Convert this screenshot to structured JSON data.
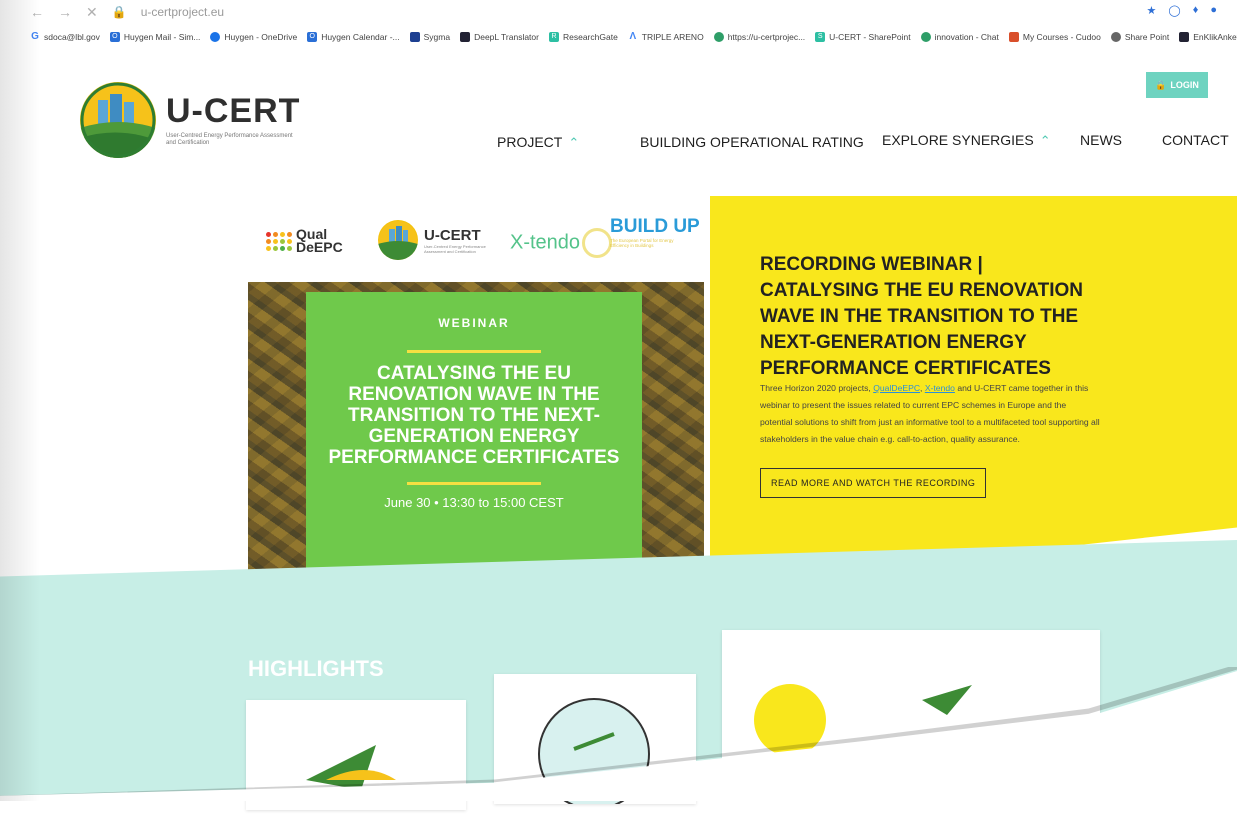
{
  "browser": {
    "url": "u-certproject.eu",
    "bookmarks": [
      {
        "label": "sdoca@lbl.gov",
        "icon": "google-icon"
      },
      {
        "label": "Huygen Mail - Sim...",
        "icon": "outlook-icon"
      },
      {
        "label": "Huygen - OneDrive",
        "icon": "onedrive-icon"
      },
      {
        "label": "Huygen Calendar -...",
        "icon": "outlook-icon"
      },
      {
        "label": "Sygma",
        "icon": "eu-flag-icon"
      },
      {
        "label": "DeepL Translator",
        "icon": "deepl-icon"
      },
      {
        "label": "ResearchGate",
        "icon": "researchgate-icon"
      },
      {
        "label": "TRIPLE ARENO",
        "icon": "triple-icon"
      },
      {
        "label": "https://u-certprojec...",
        "icon": "site-icon"
      },
      {
        "label": "U-CERT - SharePoint",
        "icon": "sharepoint-icon"
      },
      {
        "label": "innovation - Chat",
        "icon": "chat-icon"
      },
      {
        "label": "My Courses - Cudoo",
        "icon": "cudoo-icon"
      },
      {
        "label": "Share Point",
        "icon": "sharepoint-icon"
      },
      {
        "label": "EnKlikAnketa - 1KA...",
        "icon": "survey-icon"
      }
    ]
  },
  "header": {
    "login_label": "LOGIN",
    "brand_title": "U-CERT",
    "brand_subtitle": "User-Centred Energy Performance Assessment and Certification"
  },
  "nav": {
    "project": "PROJECT",
    "rating": "BUILDING OPERATIONAL RATING",
    "synergies": "EXPLORE SYNERGIES",
    "news": "NEWS",
    "contact": "CONTACT"
  },
  "partners": {
    "qual_line1": "Qual",
    "qual_line2": "DeEPC",
    "ucert": "U-CERT",
    "ucert_sub": "User-Centred Energy Performance Assessment and Certification",
    "xtendo": "X-tendo",
    "buildup": "BUILD UP",
    "buildup_sub": "The European Portal for Energy Efficiency in Buildings"
  },
  "webinar": {
    "label": "WEBINAR",
    "title": "CATALYSING THE EU RENOVATION WAVE IN THE TRANSITION TO THE NEXT-GENERATION ENERGY PERFORMANCE CERTIFICATES",
    "date": "June 30 • 13:30 to 15:00 CEST"
  },
  "feature": {
    "title": "RECORDING WEBINAR | CATALYSING THE EU RENOVATION WAVE IN THE TRANSITION TO THE NEXT-GENERATION ENERGY PERFORMANCE CERTIFICATES",
    "text_before": "Three Horizon 2020 projects,",
    "link1": "QualDeEPC",
    "link2": "X-tendo",
    "text_after": "and U-CERT came together in this webinar to present the issues related to current EPC schemes in Europe and the potential solutions to shift from just an informative tool to a multifaceted tool supporting all stakeholders in the value chain e.g. call-to-action, quality assurance.",
    "button": "READ MORE AND WATCH THE RECORDING"
  },
  "highlights": {
    "title": "HIGHLIGHTS"
  },
  "colors": {
    "teal": "#6ed3c0",
    "yellow": "#f9e71c",
    "green": "#6fc94b",
    "highlight_bg": "#c7eee6"
  }
}
